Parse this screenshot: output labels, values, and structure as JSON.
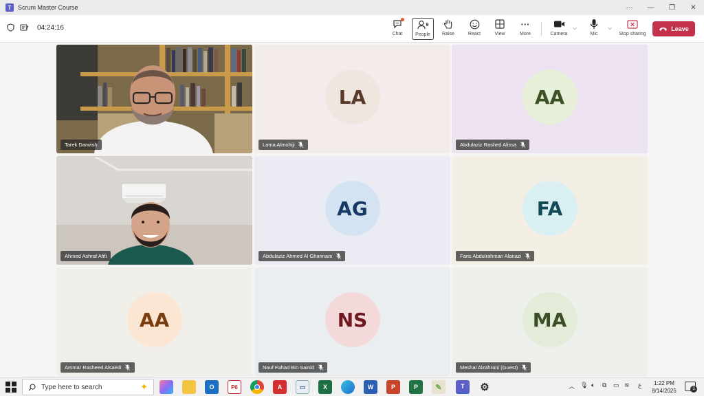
{
  "window": {
    "title": "Scrum Master Course",
    "controls": [
      "more-icon",
      "minimize-icon",
      "restore-icon",
      "close-icon"
    ]
  },
  "meeting": {
    "timer": "04:24:16",
    "toolbar": {
      "chat": "Chat",
      "people": "People",
      "people_count": "9",
      "raise": "Raise",
      "react": "React",
      "view": "View",
      "more": "More",
      "camera": "Camera",
      "mic": "Mic",
      "stop_sharing": "Stop sharing",
      "leave": "Leave"
    },
    "participants": [
      {
        "name": "Tarek Darwish",
        "type": "video",
        "muted": false
      },
      {
        "name": "Lama Almohiji",
        "initials": "LA",
        "muted": true,
        "avatar_bg": "#efe6df",
        "avatar_fg": "#5a3a28",
        "tile_bg": "#f3ecea"
      },
      {
        "name": "Abdulaziz Rashed Alissa",
        "initials": "AA",
        "muted": true,
        "avatar_bg": "#e7efd9",
        "avatar_fg": "#3d5224",
        "tile_bg": "#ece2f0"
      },
      {
        "name": "Ahmed Ashraf Afifi",
        "type": "video",
        "muted": false
      },
      {
        "name": "Abdulaziz Ahmed Al Ghannam",
        "initials": "AG",
        "muted": true,
        "avatar_bg": "#d3e3f1",
        "avatar_fg": "#163a63",
        "tile_bg": "#ebecf3"
      },
      {
        "name": "Faris Abdulrahman Alanazi",
        "initials": "FA",
        "muted": true,
        "avatar_bg": "#daeff1",
        "avatar_fg": "#124b55",
        "tile_bg": "#f4efe5"
      },
      {
        "name": "Ammar Rasheed Alsaedi",
        "initials": "AA",
        "muted": true,
        "avatar_bg": "#fbe6d3",
        "avatar_fg": "#7a3c0d",
        "tile_bg": "#f1efea"
      },
      {
        "name": "Nouf Fahad Bin Sainid",
        "initials": "NS",
        "muted": true,
        "avatar_bg": "#f3d9d9",
        "avatar_fg": "#6f1a22",
        "tile_bg": "#eaeef0"
      },
      {
        "name": "Meshal Alzahrani (Guest)",
        "initials": "MA",
        "muted": true,
        "avatar_bg": "#e3ecd9",
        "avatar_fg": "#3b4e25",
        "tile_bg": "#eef0ec"
      }
    ]
  },
  "taskbar": {
    "search_placeholder": "Type here to search",
    "time": "1:22 PM",
    "date": "8/14/2025",
    "notification_count": "3",
    "apps": [
      "copilot-icon",
      "file-explorer-icon",
      "outlook-icon",
      "primavera-p6-icon",
      "chrome-icon",
      "acrobat-icon",
      "remote-desktop-icon",
      "excel-icon",
      "edge-icon",
      "word-icon",
      "powerpoint-icon",
      "project-icon",
      "paint-icon",
      "teams-icon",
      "settings-icon"
    ]
  }
}
